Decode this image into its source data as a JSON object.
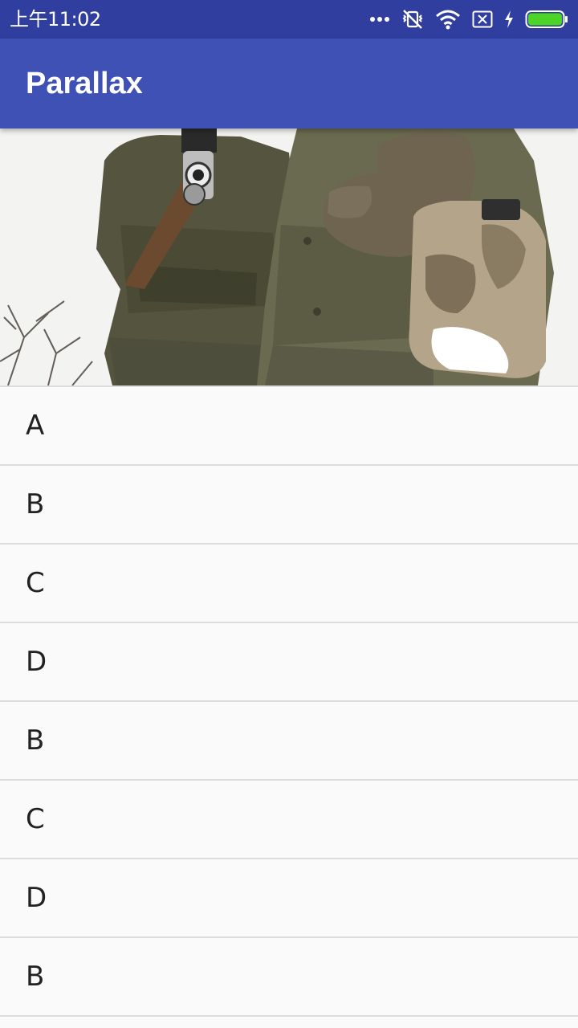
{
  "status_bar": {
    "time": "上午11:02",
    "icons": [
      "more-dots-icon",
      "vibrate-off-icon",
      "wifi-icon",
      "no-sim-icon",
      "charging-icon",
      "battery-icon"
    ],
    "color": "#303f9f"
  },
  "app_bar": {
    "title": "Parallax",
    "color": "#3f51b5"
  },
  "header_image": {
    "description_icon": "soldiers-photo"
  },
  "list": {
    "items": [
      "A",
      "B",
      "C",
      "D",
      "B",
      "C",
      "D",
      "B"
    ]
  }
}
